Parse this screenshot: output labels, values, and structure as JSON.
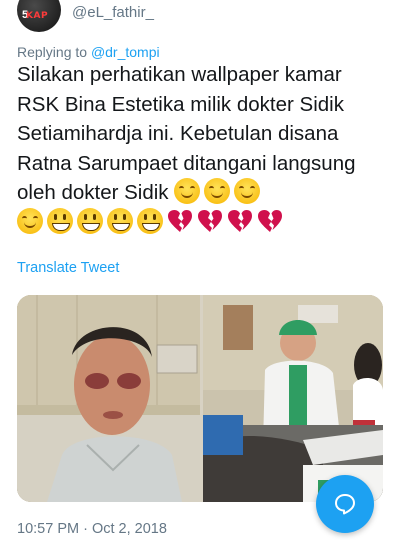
{
  "header": {
    "username": "@eL_fathir_",
    "avatar_badge": "KAP",
    "avatar_num": "5"
  },
  "reply": {
    "prefix": "Replying to ",
    "mention": "@dr_tompi"
  },
  "tweet": {
    "text": "Silakan perhatikan wallpaper kamar RSK Bina Estetika milik dokter Sidik Setiamihardja ini.  Kebetulan disana Ratna Sarumpaet ditangani langsung oleh dokter Sidik ",
    "emojis": [
      "smile",
      "smile",
      "smile",
      "smile",
      "grin",
      "grin",
      "grin",
      "grin",
      "broken-heart",
      "broken-heart",
      "broken-heart",
      "broken-heart"
    ]
  },
  "translate_label": "Translate Tweet",
  "media": {
    "count": 2
  },
  "timestamp": "10:57 PM · Oct 2, 2018",
  "colors": {
    "accent": "#1da1f2",
    "secondary_text": "#657786",
    "text": "#14171a",
    "broken_heart": "#d0104c"
  }
}
